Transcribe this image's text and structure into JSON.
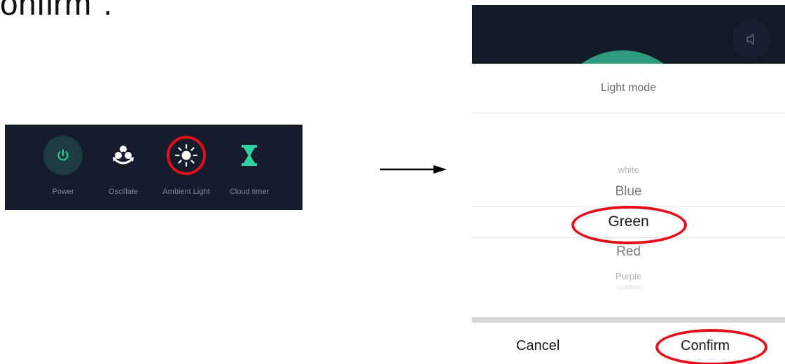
{
  "heading_fragment": "onfirm\".",
  "control_bar": {
    "items": [
      {
        "label": "Power",
        "icon": "power-icon"
      },
      {
        "label": "Oscillate",
        "icon": "oscillate-icon"
      },
      {
        "label": "Ambient Light",
        "icon": "sun-icon"
      },
      {
        "label": "Cloud timer",
        "icon": "hourglass-icon"
      }
    ]
  },
  "light_sheet": {
    "title": "Light mode",
    "options": [
      "white",
      "Blue",
      "Green",
      "Red",
      "Purple",
      "Gradient"
    ],
    "selected": "Green",
    "cancel_label": "Cancel",
    "confirm_label": "Confirm"
  },
  "colors": {
    "bar_bg": "#151c2c",
    "accent_teal": "#2ed3a0",
    "highlight_red": "#e50f1c",
    "header_bg": "#121b28"
  }
}
